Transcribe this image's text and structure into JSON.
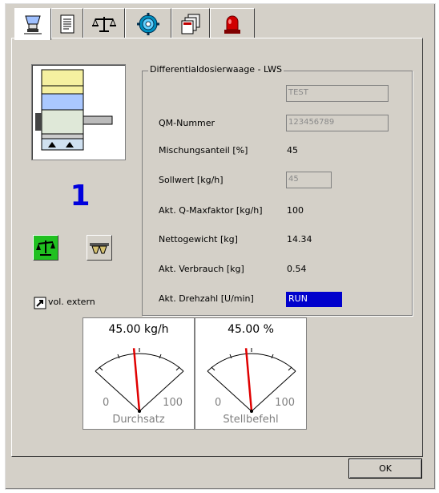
{
  "tabs": [
    {
      "icon": "hopper-icon"
    },
    {
      "icon": "document-icon"
    },
    {
      "icon": "balance-icon"
    },
    {
      "icon": "gear-icon"
    },
    {
      "icon": "files-icon"
    },
    {
      "icon": "alarm-light-icon"
    }
  ],
  "left": {
    "dosing_unit_number": "1",
    "vol_extern_label": "vol. extern"
  },
  "group": {
    "title": "Differentialdosierwaage - LWS",
    "name_value": "TEST",
    "rows": [
      {
        "label": "QM-Nummer",
        "value": "123456789"
      },
      {
        "label": "Mischungsanteil [%]",
        "value": "45"
      },
      {
        "label": "Sollwert [kg/h]",
        "value": "45"
      },
      {
        "label": "Akt. Q-Maxfaktor [kg/h]",
        "value": "100"
      },
      {
        "label": "Nettogewicht  [kg]",
        "value": "14.34"
      },
      {
        "label": "Akt. Verbrauch  [kg]",
        "value": "0.54"
      },
      {
        "label": "Akt. Drehzahl [U/min]",
        "value": "RUN"
      }
    ]
  },
  "gauges": [
    {
      "value_text": "45.00 kg/h",
      "value": 45,
      "min": "0",
      "max": "100",
      "name": "Durchsatz"
    },
    {
      "value_text": "45.00 %",
      "value": 45,
      "min": "0",
      "max": "100",
      "name": "Stellbefehl"
    }
  ],
  "buttons": {
    "ok": "OK"
  },
  "colors": {
    "bg": "#d4d0c8",
    "accent": "#0000cc",
    "needle": "#e00000",
    "number": "#0000dd"
  }
}
